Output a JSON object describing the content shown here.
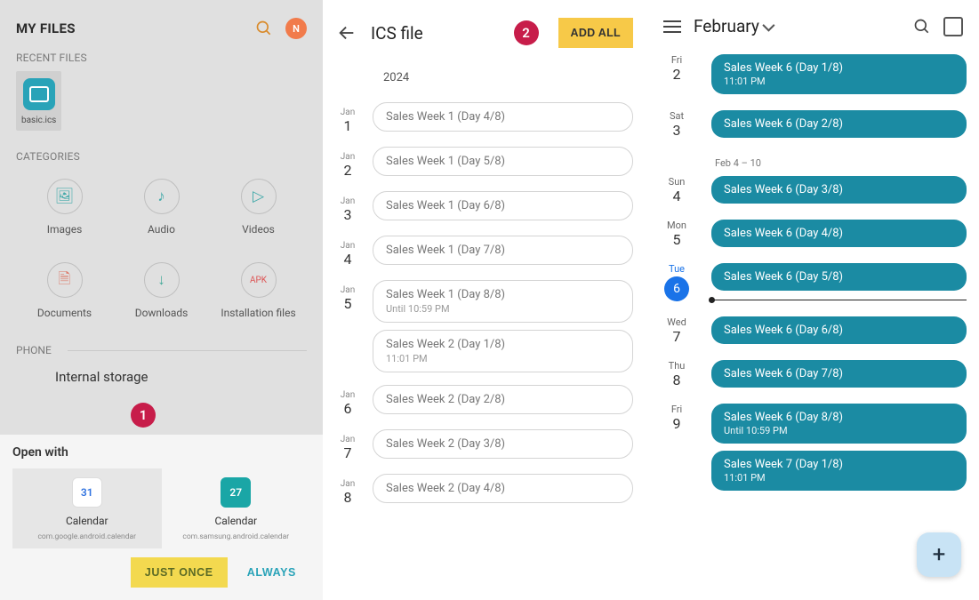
{
  "panel1": {
    "title": "MY FILES",
    "badge_letter": "N",
    "recent_label": "RECENT FILES",
    "recent_file": "basic.ics",
    "categories_label": "CATEGORIES",
    "categories": [
      {
        "label": "Images",
        "icon": "🖼"
      },
      {
        "label": "Audio",
        "icon": "♪"
      },
      {
        "label": "Videos",
        "icon": "▷"
      },
      {
        "label": "Documents",
        "icon": "🗎",
        "color": "#d76"
      },
      {
        "label": "Downloads",
        "icon": "↓",
        "color": "#4a9"
      },
      {
        "label": "Installation files",
        "icon": "APK",
        "color": "#d55",
        "small": true
      }
    ],
    "phone_label": "PHONE",
    "internal_storage": "Internal storage",
    "openwith": {
      "title": "Open with",
      "apps": [
        {
          "name": "Calendar",
          "pkg": "com.google.android.calendar",
          "day": "31",
          "variant": "gcal",
          "selected": true
        },
        {
          "name": "Calendar",
          "pkg": "com.samsung.android.calendar",
          "day": "27",
          "variant": "scal",
          "selected": false
        }
      ],
      "just_once": "JUST ONCE",
      "always": "ALWAYS"
    }
  },
  "panel2": {
    "title": "ICS file",
    "add_all": "ADD ALL",
    "year": "2024",
    "days": [
      {
        "m": "Jan",
        "d": "1",
        "events": [
          {
            "t": "Sales Week 1 (Day 4/8)"
          }
        ]
      },
      {
        "m": "Jan",
        "d": "2",
        "events": [
          {
            "t": "Sales Week 1 (Day 5/8)"
          }
        ]
      },
      {
        "m": "Jan",
        "d": "3",
        "events": [
          {
            "t": "Sales Week 1 (Day 6/8)"
          }
        ]
      },
      {
        "m": "Jan",
        "d": "4",
        "events": [
          {
            "t": "Sales Week 1 (Day 7/8)"
          }
        ]
      },
      {
        "m": "Jan",
        "d": "5",
        "events": [
          {
            "t": "Sales Week 1 (Day 8/8)",
            "s": "Until 10:59 PM"
          },
          {
            "t": "Sales Week 2 (Day 1/8)",
            "s": "11:01 PM"
          }
        ]
      },
      {
        "m": "Jan",
        "d": "6",
        "events": [
          {
            "t": "Sales Week 2 (Day 2/8)"
          }
        ]
      },
      {
        "m": "Jan",
        "d": "7",
        "events": [
          {
            "t": "Sales Week 2 (Day 3/8)"
          }
        ]
      },
      {
        "m": "Jan",
        "d": "8",
        "events": [
          {
            "t": "Sales Week 2 (Day 4/8)"
          }
        ]
      }
    ]
  },
  "panel3": {
    "month": "February",
    "week_label": "Feb 4 – 10",
    "days": [
      {
        "w": "Fri",
        "d": "2",
        "events": [
          {
            "t": "Sales Week 6 (Day 1/8)",
            "s": "11:01 PM"
          }
        ]
      },
      {
        "w": "Sat",
        "d": "3",
        "events": [
          {
            "t": "Sales Week 6 (Day 2/8)"
          }
        ]
      },
      {
        "break": true
      },
      {
        "w": "Sun",
        "d": "4",
        "events": [
          {
            "t": "Sales Week 6 (Day 3/8)"
          }
        ]
      },
      {
        "w": "Mon",
        "d": "5",
        "events": [
          {
            "t": "Sales Week 6 (Day 4/8)"
          }
        ]
      },
      {
        "w": "Tue",
        "d": "6",
        "today": true,
        "events": [
          {
            "t": "Sales Week 6 (Day 5/8)"
          }
        ],
        "nowline": true
      },
      {
        "w": "Wed",
        "d": "7",
        "events": [
          {
            "t": "Sales Week 6 (Day 6/8)"
          }
        ]
      },
      {
        "w": "Thu",
        "d": "8",
        "events": [
          {
            "t": "Sales Week 6 (Day 7/8)"
          }
        ]
      },
      {
        "w": "Fri",
        "d": "9",
        "events": [
          {
            "t": "Sales Week 6 (Day 8/8)",
            "s": "Until 10:59 PM"
          },
          {
            "t": "Sales Week 7 (Day 1/8)",
            "s": "11:01 PM"
          }
        ]
      }
    ]
  },
  "annotations": {
    "one": "1",
    "two": "2"
  }
}
